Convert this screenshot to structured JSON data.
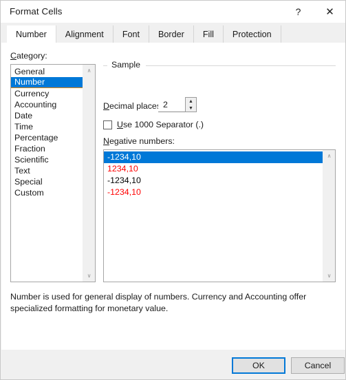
{
  "window": {
    "title": "Format Cells",
    "help_icon": "?",
    "close_icon": "✕"
  },
  "tabs": [
    {
      "label": "Number",
      "active": true
    },
    {
      "label": "Alignment",
      "active": false
    },
    {
      "label": "Font",
      "active": false
    },
    {
      "label": "Border",
      "active": false
    },
    {
      "label": "Fill",
      "active": false
    },
    {
      "label": "Protection",
      "active": false
    }
  ],
  "category": {
    "label": "Category:",
    "label_accel": "C",
    "items": [
      "General",
      "Number",
      "Currency",
      "Accounting",
      "Date",
      "Time",
      "Percentage",
      "Fraction",
      "Scientific",
      "Text",
      "Special",
      "Custom"
    ],
    "selected": "Number",
    "scroll_up_icon": "∧",
    "scroll_down_icon": "∨"
  },
  "sample": {
    "title": "Sample",
    "value": ""
  },
  "decimal_places": {
    "label": "Decimal places:",
    "label_accel": "D",
    "value": "2",
    "spin_up_icon": "▲",
    "spin_down_icon": "▼"
  },
  "thousands_separator": {
    "label": "Use 1000 Separator (.)",
    "label_accel": "U",
    "checked": false
  },
  "negative_numbers": {
    "label": "Negative numbers:",
    "label_accel": "N",
    "items": [
      {
        "text": "-1234,10",
        "color": "#000000",
        "selected": true
      },
      {
        "text": "1234,10",
        "color": "#ff0000",
        "selected": false
      },
      {
        "text": "-1234,10",
        "color": "#000000",
        "selected": false
      },
      {
        "text": "-1234,10",
        "color": "#ff0000",
        "selected": false
      }
    ],
    "scroll_up_icon": "∧",
    "scroll_down_icon": "∨"
  },
  "description": "Number is used for general display of numbers.  Currency and Accounting offer specialized formatting for monetary value.",
  "buttons": {
    "ok": "OK",
    "cancel": "Cancel"
  },
  "colors": {
    "selection_blue": "#0078d7",
    "focus_orange": "#e8850a",
    "negative_red": "#ff0000",
    "dialog_gray": "#f0f0f0"
  }
}
